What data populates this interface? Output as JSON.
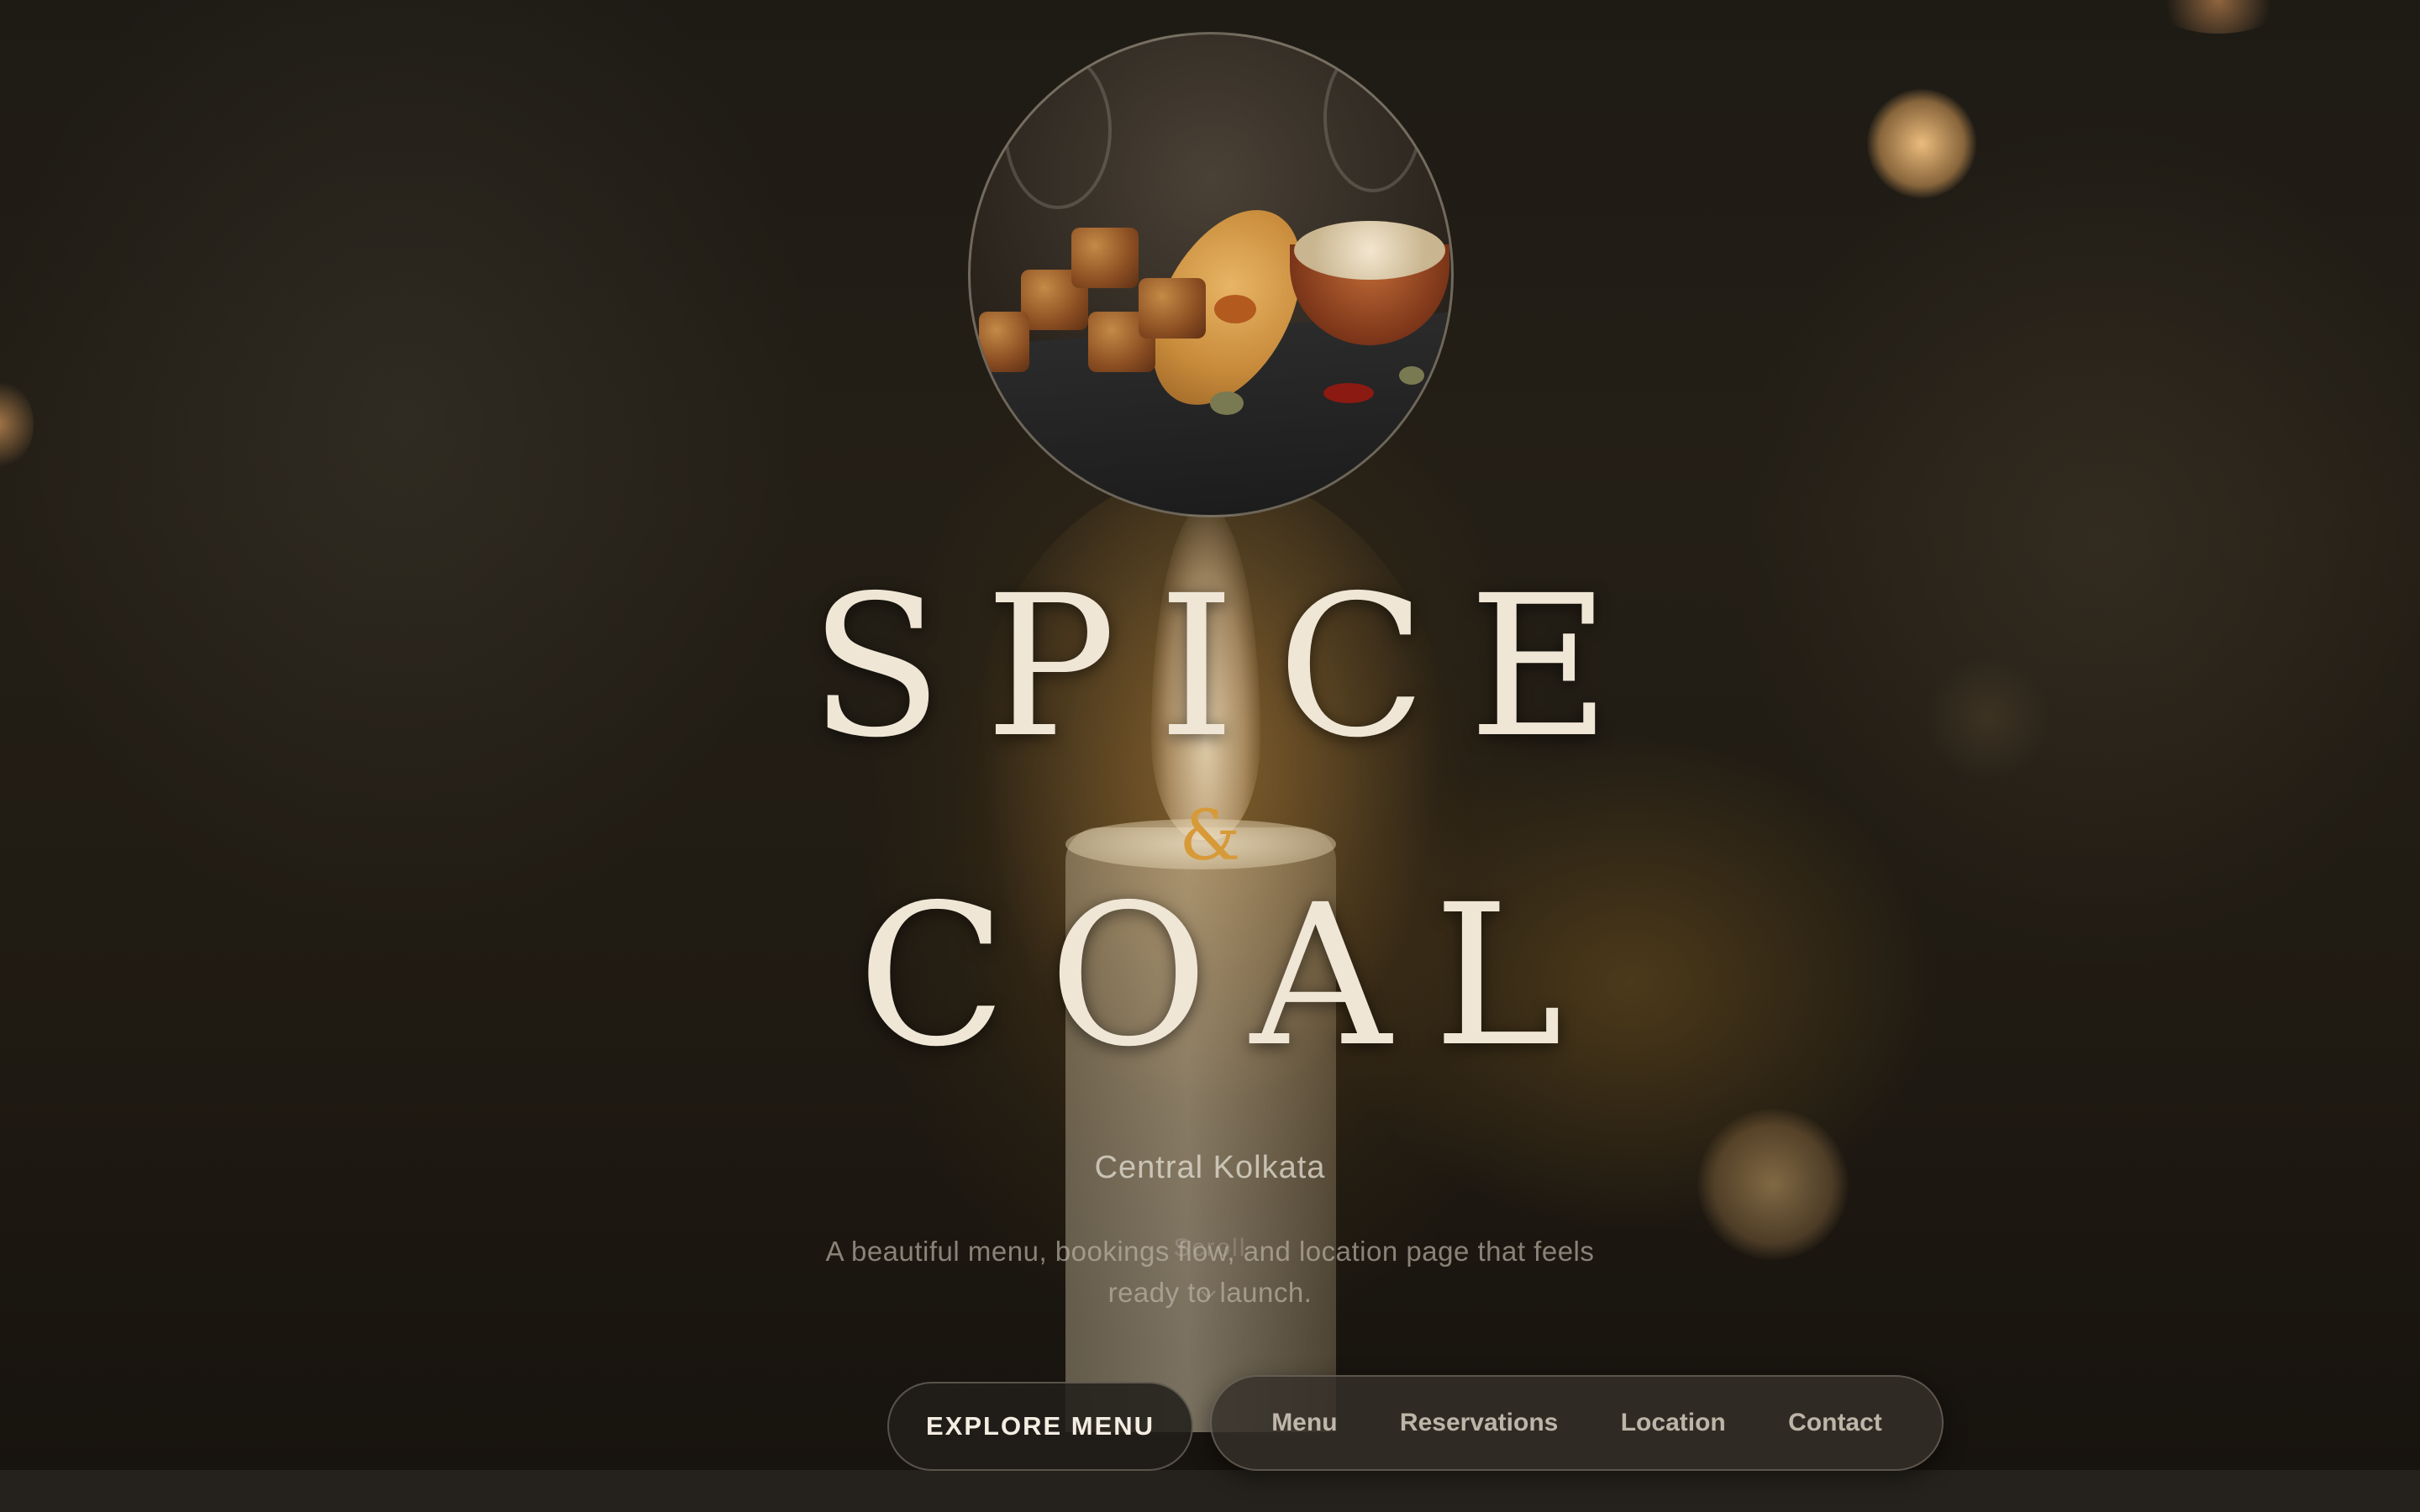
{
  "brand": {
    "title_line_1": "SPICE",
    "ampersand": "&",
    "title_line_2": "COAL"
  },
  "hero": {
    "location": "Central Kolkata",
    "tagline": "A beautiful menu, bookings flow, and location page that feels ready to launch.",
    "scroll_hint": "Scroll"
  },
  "cta": {
    "explore_label": "EXPLORE MENU"
  },
  "nav": {
    "items": [
      {
        "label": "Menu"
      },
      {
        "label": "Reservations"
      },
      {
        "label": "Location"
      },
      {
        "label": "Contact"
      }
    ]
  },
  "colors": {
    "accent": "#d79a38",
    "title": "#efe6d6",
    "background": "#17130d"
  }
}
